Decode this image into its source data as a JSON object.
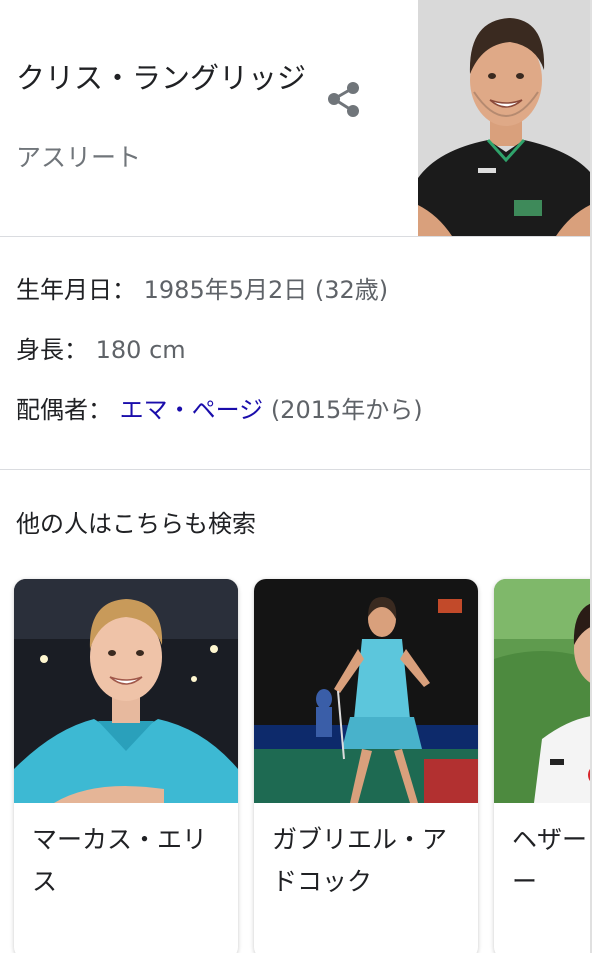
{
  "profile": {
    "name": "クリス・ラングリッジ",
    "category": "アスリート"
  },
  "facts": [
    {
      "label": "生年月日：",
      "value": "1985年5月2日 (32歳)"
    },
    {
      "label": "身長：",
      "value": "180 cm"
    },
    {
      "label": "配偶者：",
      "link": "エマ・ページ",
      "value": "(2015年から)"
    }
  ],
  "related": {
    "title": "他の人はこちらも検索",
    "people": [
      {
        "name": "マーカス・エリス"
      },
      {
        "name": "ガブリエル・アドコック"
      },
      {
        "name": "ヘザー・オリバー"
      }
    ]
  },
  "colors": {
    "link": "#1a0dab",
    "secondary_text": "#70757a",
    "divider": "#dadce0"
  }
}
